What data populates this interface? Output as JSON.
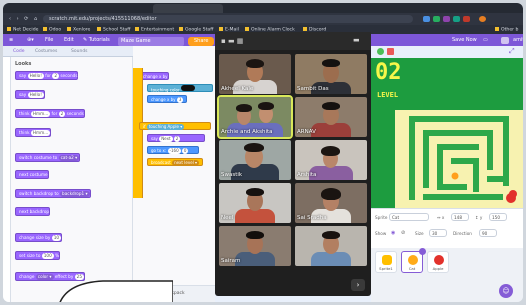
{
  "browser": {
    "url": "scratch.mit.edu/projects/415511068/editor",
    "bookmarks": [
      "Net Decide",
      "Odoo",
      "Xenlore",
      "School Staff",
      "Entertainment",
      "Google Staff",
      "E-Mail",
      "Online Alarm Clock",
      "Discord",
      "Other b"
    ]
  },
  "menu": {
    "file": "File",
    "edit": "Edit",
    "tutorials": "Tutorials",
    "project_title": "Maze Game",
    "share": "Share",
    "save_now": "Save Now",
    "user": "amit"
  },
  "palette": {
    "tabs": [
      "Code",
      "Costumes",
      "Sounds"
    ],
    "heading": "Looks",
    "blocks": [
      {
        "pre": "say",
        "arg": "Hello!",
        "post": "for",
        "arg2": "2",
        "post2": "seconds"
      },
      {
        "pre": "say",
        "arg": "Hello!"
      },
      {
        "pre": "think",
        "arg": "Hmm...",
        "post": "for",
        "arg2": "2",
        "post2": "seconds"
      },
      {
        "pre": "think",
        "arg": "Hmm..."
      },
      {
        "pre": "switch costume to",
        "arg": "cat-a2 ▾"
      },
      {
        "pre": "next costume"
      },
      {
        "pre": "switch backdrop to",
        "arg": "backdrop1 ▾"
      },
      {
        "pre": "next backdrop"
      },
      {
        "pre": "change size by",
        "arg": "10"
      },
      {
        "pre": "set size to",
        "arg": "100",
        "post": "%"
      },
      {
        "pre": "change",
        "arg": "color ▾",
        "post": "effect by",
        "arg2": "25"
      }
    ]
  },
  "workspace": {
    "blocks": [
      "change x by",
      "touching color",
      "change x by",
      "if",
      "touching Apple ▾",
      "say",
      "go to x:",
      "broadcast",
      "next level ▾"
    ],
    "backpack": "Backpack"
  },
  "zoom": {
    "participants": [
      {
        "name": "Akheel Kale",
        "active": false
      },
      {
        "name": "Sambit Das",
        "active": false
      },
      {
        "name": "Archie and Akshita",
        "active": true
      },
      {
        "name": "ARNAV",
        "active": false
      },
      {
        "name": "Swastik",
        "active": false
      },
      {
        "name": "Arshita",
        "active": false
      },
      {
        "name": "Neel",
        "active": false
      },
      {
        "name": "Sai Sradha",
        "active": false
      },
      {
        "name": "Sairam",
        "active": false
      },
      {
        "name": "",
        "active": false
      }
    ],
    "next": "›"
  },
  "stage": {
    "score": "02",
    "level": "LEVEL"
  },
  "sprite_info": {
    "sprite_label": "Sprite",
    "sprite_name": "Cat",
    "x_value": "148",
    "y_value": "150",
    "show_label": "Show",
    "size_label": "Size",
    "size_value": "30",
    "direction_label": "Direction",
    "direction_value": "90"
  },
  "sprites": [
    "Sprite1",
    "Cat",
    "Apple"
  ],
  "colors": {
    "menu": "#7d57d8",
    "looks": "#9966ff",
    "control": "#ffbf00",
    "stage_bg": "#1d9c3f"
  }
}
